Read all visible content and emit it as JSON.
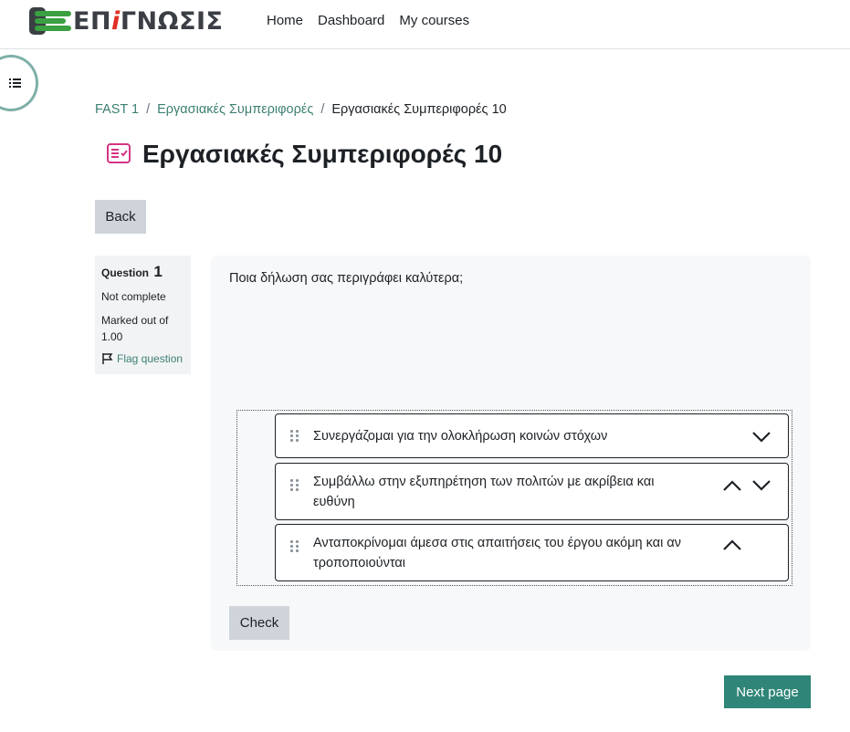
{
  "brand": {
    "logo_text_before": "ΕΠ",
    "logo_text_accent": "i",
    "logo_text_after": "ΓΝΩΣΙΣ"
  },
  "nav": {
    "items": [
      "Home",
      "Dashboard",
      "My courses"
    ]
  },
  "drawer": {
    "icon": "list-icon"
  },
  "breadcrumb": {
    "items": [
      "FAST 1",
      "Εργασιακές Συμπεριφορές"
    ],
    "current": "Εργασιακές Συμπεριφορές 10",
    "separator": "/"
  },
  "page": {
    "title": "Εργασιακές Συμπεριφορές 10",
    "icon": "quiz-icon",
    "back_label": "Back"
  },
  "question_info": {
    "label": "Question",
    "number": "1",
    "state": "Not complete",
    "grade": "Marked out of 1.00",
    "flag_label": "Flag question"
  },
  "question": {
    "text": "Ποια δήλωση σας περιγράφει καλύτερα;",
    "items": [
      {
        "text": "Συνεργάζομαι για την ολοκλήρωση κοινών στόχων",
        "up": false,
        "down": true
      },
      {
        "text": "Συμβάλλω στην εξυπηρέτηση των πολιτών με ακρίβεια και ευθύνη",
        "up": true,
        "down": true
      },
      {
        "text": "Ανταποκρίνομαι άμεσα στις απαιτήσεις του έργου ακόμη και αν τροποποιούνται",
        "up": true,
        "down": false
      }
    ],
    "check_label": "Check"
  },
  "footer": {
    "next_label": "Next page"
  },
  "colors": {
    "accent": "#2f8578",
    "link": "#3c7f73",
    "logo_green": "#3aa041",
    "logo_red": "#e02f24",
    "quiz_icon": "#d63384"
  }
}
